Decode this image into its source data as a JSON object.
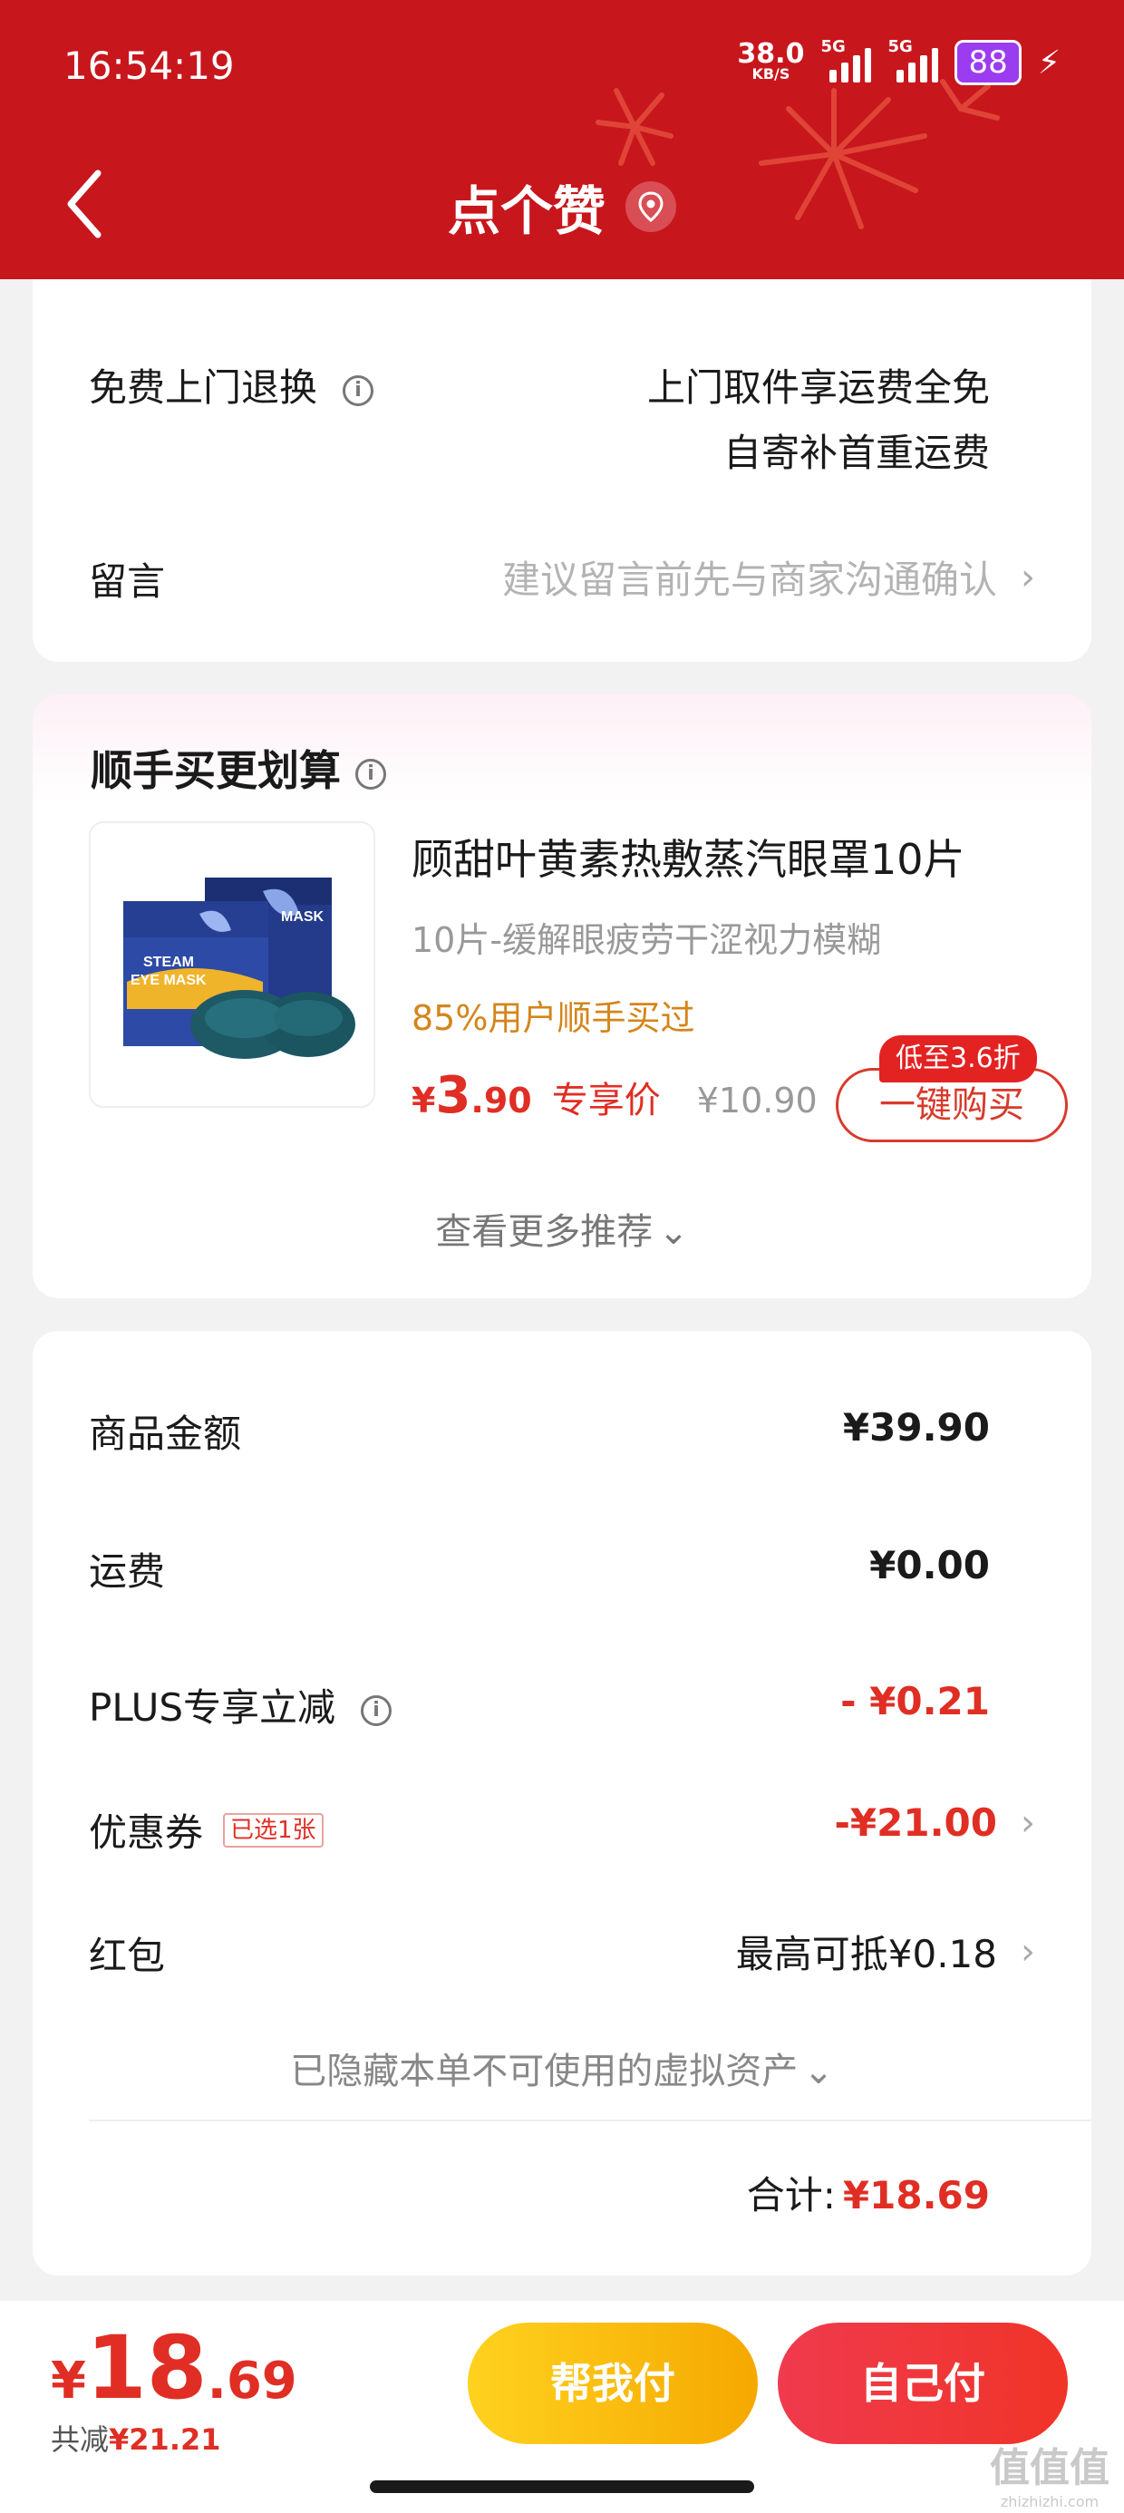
{
  "status_bar": {
    "time": "16:54:19",
    "net_speed": "38.0",
    "net_unit": "KB/S",
    "signal_label": "5G",
    "signal2_label": "5G",
    "battery": "88"
  },
  "header": {
    "title": "点个赞"
  },
  "return_section": {
    "label": "免费上门退换",
    "line1": "上门取件享运费全免",
    "line2": "自寄补首重运费"
  },
  "message": {
    "label": "留言",
    "placeholder": "建议留言前先与商家沟通确认"
  },
  "recommend": {
    "title": "顺手买更划算",
    "product_name": "顾甜叶黄素热敷蒸汽眼罩10片",
    "product_desc": "10片-缓解眼疲劳干涩视力模糊",
    "buy_rate": "85%用户顺手买过",
    "currency": "¥",
    "price_int": "3",
    "price_dec": ".90",
    "price_label": "专享价",
    "original_price": "¥10.90",
    "discount_tag": "低至3.6折",
    "buy_button": "一键购买",
    "more": "查看更多推荐",
    "img_text1": "STEAM",
    "img_text2": "EYE MASK",
    "img_text3": "MASK"
  },
  "summary": {
    "goods_label": "商品金额",
    "goods_value": "¥39.90",
    "shipping_label": "运费",
    "shipping_value": "¥0.00",
    "plus_label": "PLUS专享立减",
    "plus_value": "- ¥0.21",
    "coupon_label": "优惠券",
    "coupon_badge": "已选1张",
    "coupon_value": "-¥21.00",
    "redpacket_label": "红包",
    "redpacket_value": "最高可抵¥0.18",
    "hidden_note": "已隐藏本单不可使用的虚拟资产",
    "total_label": "合计:",
    "total_value": "¥18.69"
  },
  "bottom_bar": {
    "currency": "¥",
    "price_int": "18",
    "price_dec": ".69",
    "saved_label": "共减",
    "saved_value": "¥21.21",
    "help_pay": "帮我付",
    "self_pay": "自己付"
  },
  "watermark": {
    "main": "值值值",
    "sub": "zhizhizhi.com"
  },
  "colors": {
    "header_red": "#c8161d",
    "accent_red": "#e02e24",
    "orange": "#d4851c",
    "help_pay_gradient": [
      "#ffd21f",
      "#f5a800"
    ],
    "self_pay_gradient": [
      "#f03a4e",
      "#f03428"
    ]
  }
}
